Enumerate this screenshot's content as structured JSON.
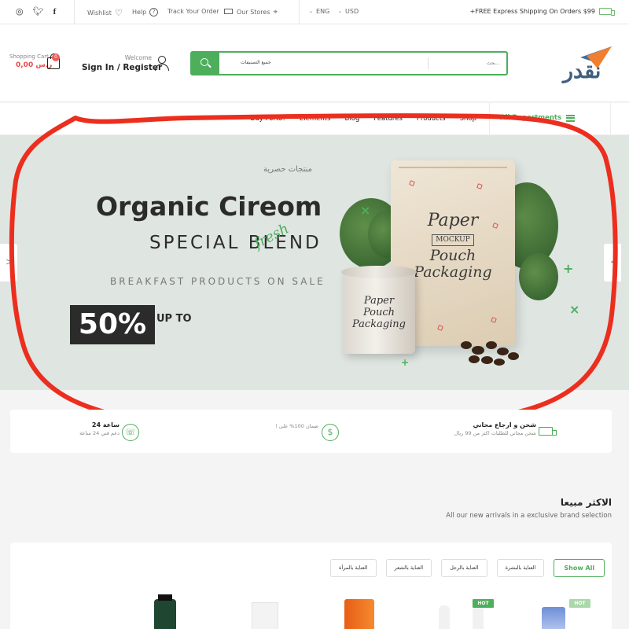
{
  "topbar": {
    "wishlist": "Wishlist",
    "help": "Help",
    "track": "Track Your Order",
    "stores": "Our Stores",
    "language": "ENG",
    "currency": "USD",
    "shipping": "+FREE Express Shipping On Orders $99"
  },
  "header": {
    "cart_label": "Shopping Cart",
    "cart_count": "0",
    "cart_total": "0,00 ر.س",
    "welcome": "Welcome",
    "sign_in": "Sign In / Register",
    "search_category": "جميع التصنيفات",
    "search_placeholder": "بحث...",
    "logo_text": "نقدر"
  },
  "nav": {
    "items": [
      "Buy Porto!",
      "Elements",
      "Blog",
      "Features",
      "Products",
      "Shop"
    ],
    "departments": "All Departments"
  },
  "hero": {
    "tag": "منتجات حصرية",
    "title": "Organic Cireom",
    "subtitle": "SPECIAL BLEND",
    "fresh": "fresh",
    "tagline": "BREAKFAST PRODUCTS ON SALE",
    "discount": "50%",
    "upto": "UP TO",
    "bag_line1": "Paper",
    "bag_line2": "MOCKUP",
    "bag_line3": "Pouch",
    "bag_line4": "Packaging",
    "tin_line1": "Paper",
    "tin_line2": "Pouch",
    "tin_line3": "Packaging"
  },
  "features": [
    {
      "title": "شحن و ارجاع مجاني",
      "subtitle": "شحن مجاني للطلبات اكثر من 99 ريال",
      "icon": "truck-icon"
    },
    {
      "title": "",
      "subtitle": "ضمان 100% على ا",
      "icon": "dollar-icon"
    },
    {
      "title": "24 ساعة",
      "subtitle": "دعم فني 24 ساعة",
      "icon": "support-icon"
    }
  ],
  "bestsellers": {
    "title": "الاكثر مبيعا",
    "subtitle": "All our new arrivals in a exclusive brand selection",
    "filters": [
      "العناية بالمرأة",
      "العناية بالشعر",
      "العناية بالرجل",
      "العناية بالبشرة"
    ],
    "show_all": "Show All",
    "hot1": "HOT",
    "hot2": "HOT"
  },
  "colors": {
    "accent": "#4dae5b",
    "price": "#e54b4b",
    "hero_bg": "#dfe5e1"
  }
}
